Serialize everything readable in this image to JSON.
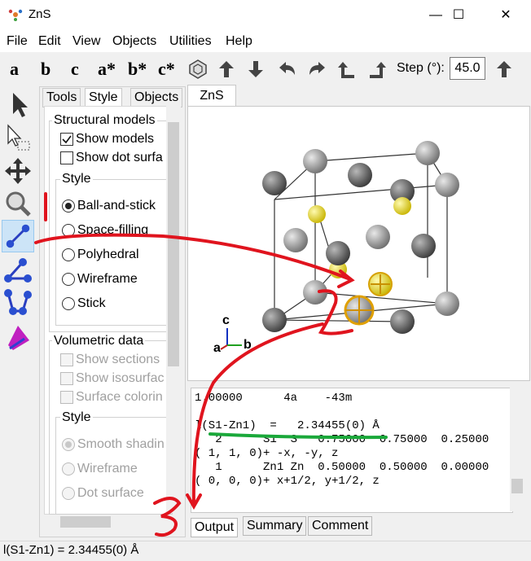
{
  "window": {
    "title": "ZnS",
    "minimize": "—",
    "maximize": "☐",
    "close": "✕"
  },
  "menu": [
    "File",
    "Edit",
    "View",
    "Objects",
    "Utilities",
    "Help"
  ],
  "toolbar": {
    "axis_buttons": [
      "a",
      "b",
      "c",
      "a*",
      "b*",
      "c*"
    ],
    "step_label": "Step (°):",
    "step_value": "45.0"
  },
  "panel_tabs": [
    "Tools",
    "Style",
    "Objects"
  ],
  "structural": {
    "title": "Structural models",
    "show_models": "Show models",
    "show_dot_surface": "Show dot surfa",
    "style_title": "Style",
    "styles": [
      "Ball-and-stick",
      "Space-filling",
      "Polyhedral",
      "Wireframe",
      "Stick"
    ],
    "selected_style": "Ball-and-stick"
  },
  "volumetric": {
    "title": "Volumetric data",
    "options": [
      "Show sections",
      "Show isosurfac",
      "Surface colorin"
    ],
    "style_title": "Style",
    "styles": [
      "Smooth shadin",
      "Wireframe",
      "Dot surface"
    ]
  },
  "viewer": {
    "tab": "ZnS",
    "axes": {
      "a": "a",
      "b": "b",
      "c": "c"
    },
    "colors": {
      "S": "#f2e600",
      "Zn": "#8c8c8c",
      "Zn_dark": "#555555"
    }
  },
  "output": {
    "lines": [
      "1.00000      4a    -43m",
      "",
      "l(S1-Zn1)  =   2.34455(0) Å",
      "   2      S1  S   0.75000  0.75000  0.25000",
      "( 1, 1, 0)+ -x, -y, z",
      "   1      Zn1 Zn  0.50000  0.50000  0.00000",
      "( 0, 0, 0)+ x+1/2, y+1/2, z"
    ],
    "tabs": [
      "Output",
      "Summary",
      "Comment"
    ]
  },
  "status": "l(S1-Zn1) = 2.34455(0) Å",
  "annotations": {
    "labels": [
      "1",
      "2",
      "3"
    ],
    "color": "#e0141e",
    "underline_color": "#1aa83a"
  }
}
